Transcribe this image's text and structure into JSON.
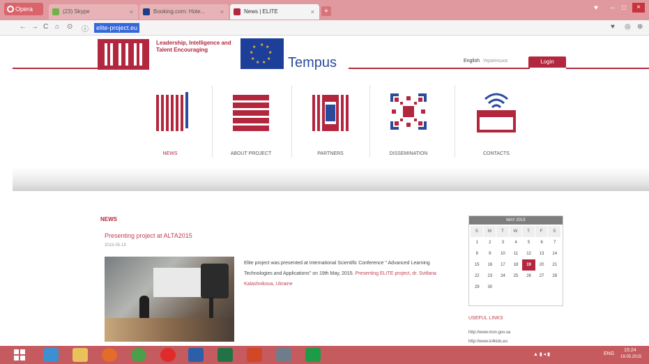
{
  "browser": {
    "opera_label": "Opera",
    "tabs": [
      {
        "title": "(23) Skype",
        "favicon_color": "#6fb348"
      },
      {
        "title": "Booking.com: Hote...",
        "favicon_color": "#1f3c88"
      },
      {
        "title": "News | ELITE",
        "favicon_color": "#b3273e"
      }
    ],
    "new_tab": "+",
    "url": "elite-project.eu"
  },
  "site": {
    "logo_text": "ELITE",
    "tagline": "Leadership, Intelligence and Talent Encouraging",
    "tempus": "Tempus",
    "lang_en": "English",
    "lang_ua": "Українська",
    "login": "Login",
    "nav": [
      {
        "label": "NEWS",
        "icon": "news-icon"
      },
      {
        "label": "ABOUT PROJECT",
        "icon": "about-icon"
      },
      {
        "label": "PARTNERS",
        "icon": "partners-icon"
      },
      {
        "label": "DISSEMINATION",
        "icon": "dissemination-icon"
      },
      {
        "label": "CONTACTS",
        "icon": "contacts-icon"
      }
    ]
  },
  "news": {
    "heading": "NEWS",
    "title": "Presenting project at ALTA2015",
    "date": "2015-05-19",
    "body_text": "Elite project was presented at International Scientific Conference \" Advanced Learning Technologies and Applications\" on 19th May, 2015.",
    "body_link": "Presenting ELITE project, dr. Svitlana Kalashnikova, Ukraine"
  },
  "calendar": {
    "title": "MAY 2015",
    "days_of_week": [
      "S",
      "M",
      "T",
      "W",
      "T",
      "F",
      "S"
    ],
    "weeks": [
      [
        "1",
        "2",
        "3",
        "4",
        "5",
        "6",
        "7"
      ],
      [
        "8",
        "9",
        "10",
        "11",
        "12",
        "13",
        "14"
      ],
      [
        "15",
        "16",
        "17",
        "18",
        "19",
        "20",
        "21"
      ],
      [
        "22",
        "23",
        "24",
        "25",
        "26",
        "27",
        "28"
      ],
      [
        "29",
        "30",
        "",
        "",
        "",
        "",
        ""
      ]
    ],
    "today": "19"
  },
  "useful_links": {
    "heading": "USEFUL LINKS",
    "links": [
      "http://www.mon.gov.ua",
      "http://www.ic4kids.eu"
    ]
  },
  "taskbar": {
    "clock_time": "15:24",
    "clock_date": "19.05.2015",
    "lang": "ENG"
  },
  "colors": {
    "brand": "#b3273e",
    "tabbar": "#e09a9f",
    "taskbar": "#c55a5f"
  }
}
